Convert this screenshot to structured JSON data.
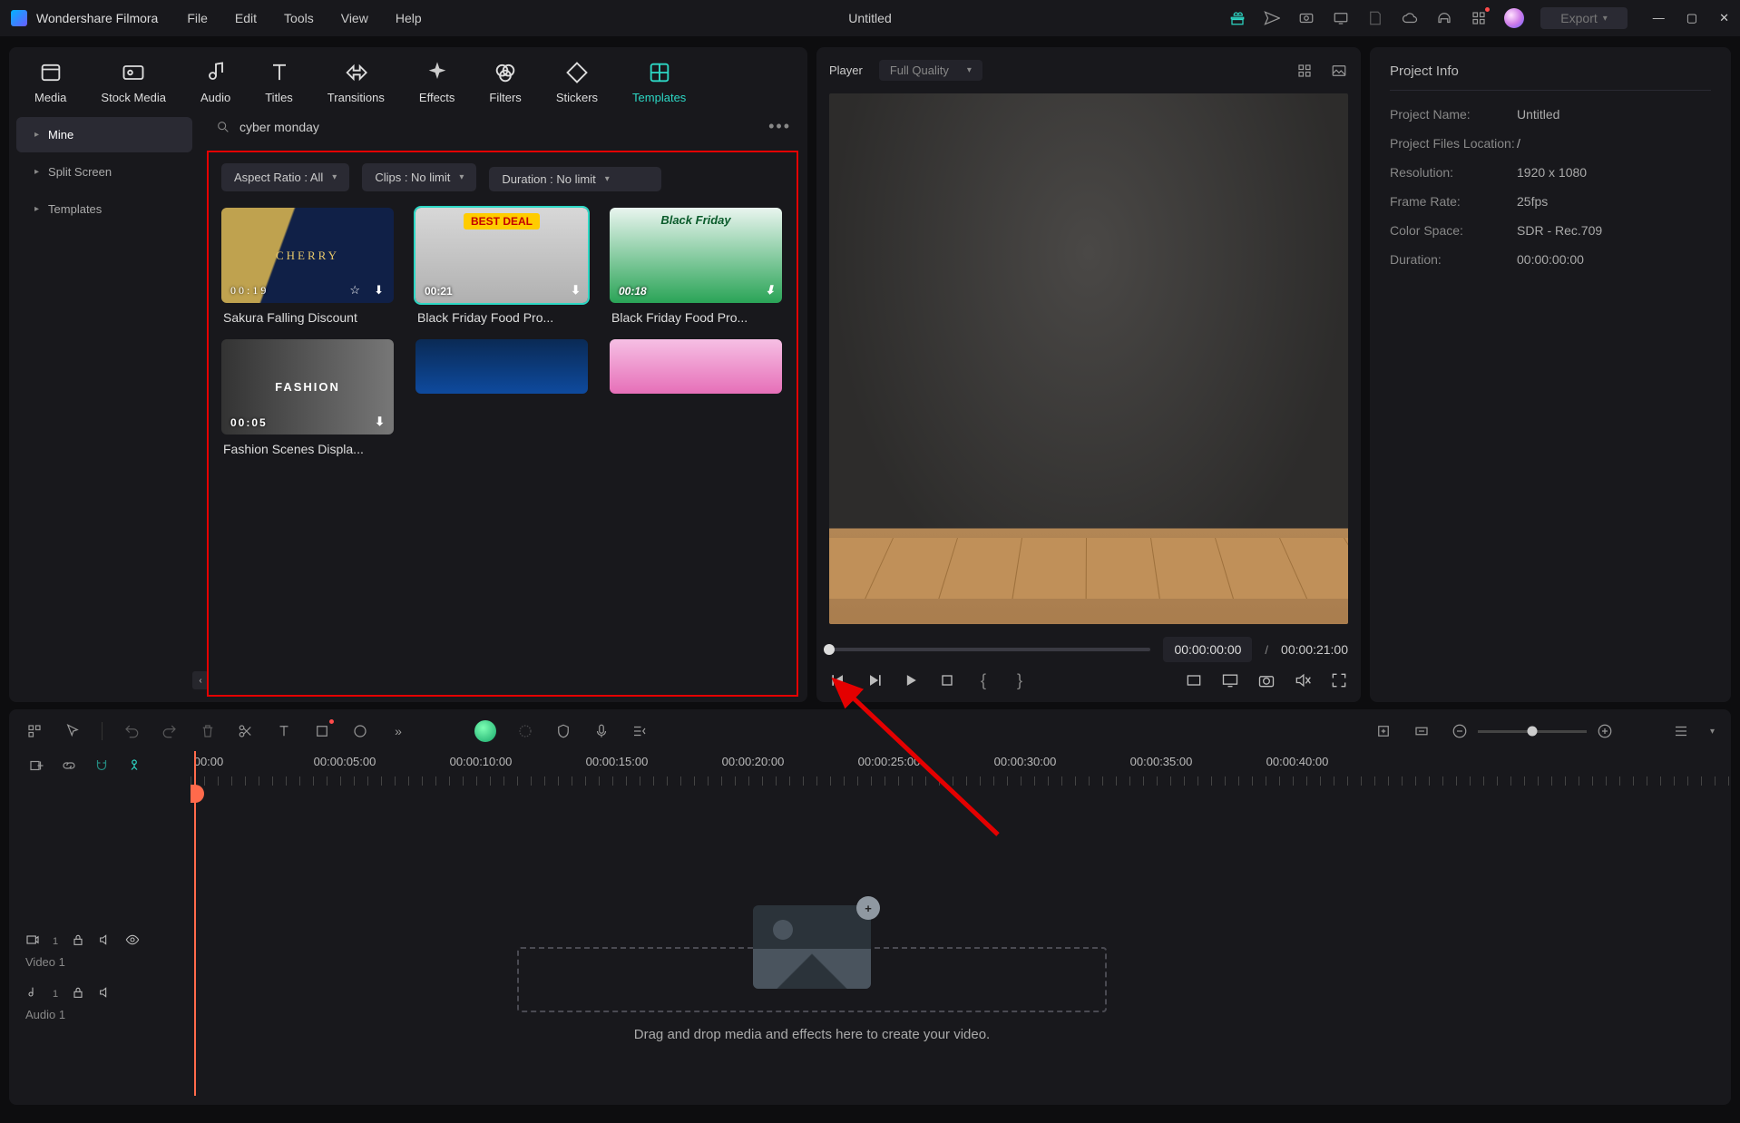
{
  "app": {
    "name": "Wondershare Filmora",
    "doc_title": "Untitled",
    "export_label": "Export"
  },
  "menus": [
    "File",
    "Edit",
    "Tools",
    "View",
    "Help"
  ],
  "tabs": [
    {
      "id": "media",
      "label": "Media"
    },
    {
      "id": "stock",
      "label": "Stock Media"
    },
    {
      "id": "audio",
      "label": "Audio"
    },
    {
      "id": "titles",
      "label": "Titles"
    },
    {
      "id": "transitions",
      "label": "Transitions"
    },
    {
      "id": "effects",
      "label": "Effects"
    },
    {
      "id": "filters",
      "label": "Filters"
    },
    {
      "id": "stickers",
      "label": "Stickers"
    },
    {
      "id": "templates",
      "label": "Templates"
    }
  ],
  "active_tab": "templates",
  "sidebar_items": [
    {
      "id": "mine",
      "label": "Mine"
    },
    {
      "id": "split",
      "label": "Split Screen"
    },
    {
      "id": "templates",
      "label": "Templates"
    }
  ],
  "sidebar_active": "mine",
  "search": {
    "value": "cyber monday",
    "placeholder": "Search"
  },
  "filters": {
    "aspect": "Aspect Ratio : All",
    "clips": "Clips : No limit",
    "duration": "Duration : No limit"
  },
  "templates": [
    {
      "title": "Sakura Falling Discount",
      "time": "00:19",
      "selected": false,
      "bg": "linear-gradient(110deg,#bfa24f 0 35%,#102047 36% 100%)",
      "text": "CHERRY"
    },
    {
      "title": "Black Friday Food Pro...",
      "time": "00:21",
      "selected": true,
      "bg": "linear-gradient(135deg,#ff3a2f,#c41a17)",
      "text": "BEST DEAL"
    },
    {
      "title": "Black Friday Food Pro...",
      "time": "00:18",
      "selected": false,
      "bg": "linear-gradient(#d7f0e6,#2aa457)",
      "text": "Black Friday"
    },
    {
      "title": "Fashion Scenes Displa...",
      "time": "00:05",
      "selected": false,
      "bg": "linear-gradient(90deg,#2c2c2c,#6a6a6a)",
      "text": "FASHION"
    },
    {
      "title": "",
      "time": "",
      "selected": false,
      "bg": "linear-gradient(#0a2a55,#0e4a9e)",
      "text": ""
    },
    {
      "title": "",
      "time": "",
      "selected": false,
      "bg": "linear-gradient(#f6bfe4,#e66fb8)",
      "text": ""
    }
  ],
  "player": {
    "title": "Player",
    "quality": "Full Quality",
    "current_time": "00:00:00:00",
    "total_time": "00:00:21:00"
  },
  "project_info": {
    "title": "Project Info",
    "name_key": "Project Name:",
    "name_val": "Untitled",
    "loc_key": "Project Files Location:",
    "loc_val": "/",
    "res_key": "Resolution:",
    "res_val": "1920 x 1080",
    "fps_key": "Frame Rate:",
    "fps_val": "25fps",
    "cs_key": "Color Space:",
    "cs_val": "SDR - Rec.709",
    "dur_key": "Duration:",
    "dur_val": "00:00:00:00"
  },
  "timeline": {
    "ticks": [
      "00:00",
      "00:00:05:00",
      "00:00:10:00",
      "00:00:15:00",
      "00:00:20:00",
      "00:00:25:00",
      "00:00:30:00",
      "00:00:35:00",
      "00:00:40:00"
    ],
    "tracks": [
      {
        "id": "video1",
        "label": "Video 1"
      },
      {
        "id": "audio1",
        "label": "Audio 1"
      }
    ],
    "drop_hint": "Drag and drop media and effects here to create your video."
  }
}
